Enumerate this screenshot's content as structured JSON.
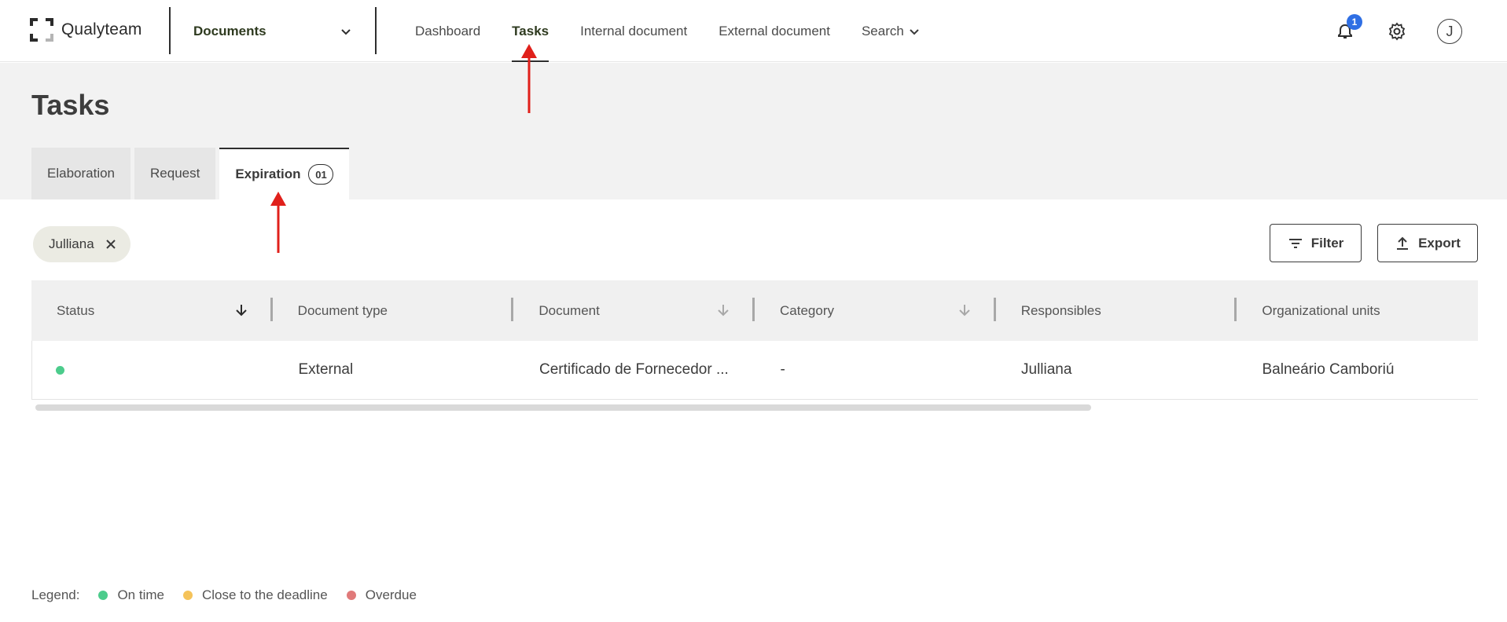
{
  "app": {
    "brand": "Qualyteam",
    "module": "Documents"
  },
  "nav": {
    "items": [
      {
        "label": "Dashboard",
        "active": false
      },
      {
        "label": "Tasks",
        "active": true
      },
      {
        "label": "Internal document",
        "active": false
      },
      {
        "label": "External document",
        "active": false
      },
      {
        "label": "Search",
        "active": false,
        "has_dropdown": true
      }
    ],
    "notifications_count": "1",
    "avatar_initial": "J"
  },
  "page": {
    "title": "Tasks",
    "tabs": [
      {
        "label": "Elaboration",
        "active": false
      },
      {
        "label": "Request",
        "active": false
      },
      {
        "label": "Expiration",
        "active": true,
        "count": "01"
      }
    ]
  },
  "filters": {
    "active_chip": "Julliana",
    "filter_label": "Filter",
    "export_label": "Export"
  },
  "table": {
    "columns": [
      "Status",
      "Document type",
      "Document",
      "Category",
      "Responsibles",
      "Organizational units"
    ],
    "rows": [
      {
        "status": "on_time",
        "document_type": "External",
        "document": "Certificado de Fornecedor ...",
        "category": "-",
        "responsibles": "Julliana",
        "organizational_units": "Balneário Camboriú"
      }
    ]
  },
  "legend": {
    "label": "Legend:",
    "items": [
      {
        "label": "On time",
        "color": "#4ccc8c"
      },
      {
        "label": "Close to the deadline",
        "color": "#f5c35a"
      },
      {
        "label": "Overdue",
        "color": "#e07a7a"
      }
    ]
  },
  "colors": {
    "accent_dark": "#2e3a1f",
    "badge_blue": "#2f6fe4",
    "annotation_red": "#e0201b",
    "status_on_time": "#4ccc8c"
  }
}
